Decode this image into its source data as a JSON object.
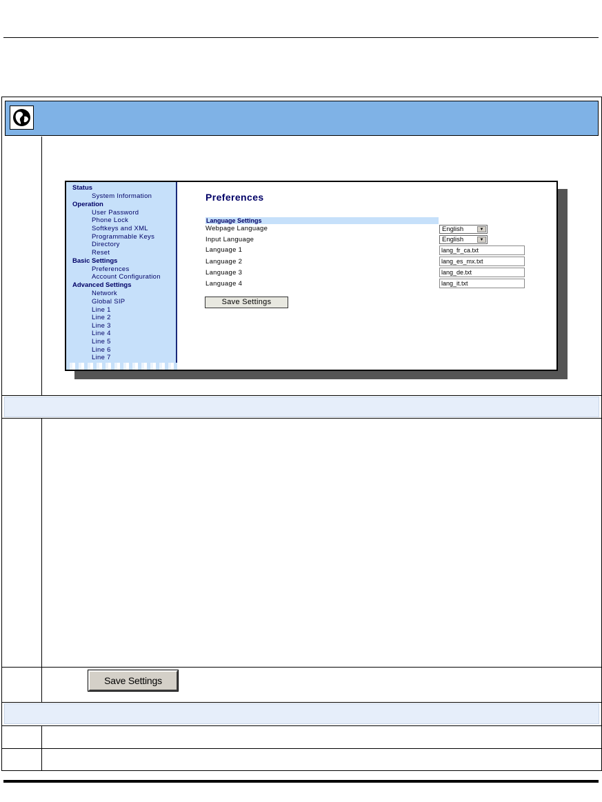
{
  "ui": {
    "sidebar": {
      "sections": [
        {
          "title": "Status",
          "items": [
            "System Information"
          ]
        },
        {
          "title": "Operation",
          "items": [
            "User Password",
            "Phone Lock",
            "Softkeys and XML",
            "Programmable Keys",
            "Directory",
            "Reset"
          ]
        },
        {
          "title": "Basic Settings",
          "items": [
            "Preferences",
            "Account Configuration"
          ]
        },
        {
          "title": "Advanced Settings",
          "items": [
            "Network",
            "Global SIP",
            "Line 1",
            "Line 2",
            "Line 3",
            "Line 4",
            "Line 5",
            "Line 6",
            "Line 7"
          ]
        }
      ]
    },
    "page_title": "Preferences",
    "language_settings_header": "Language Settings",
    "fields": [
      {
        "label": "Webpage Language",
        "type": "select",
        "value": "English"
      },
      {
        "label": "Input Language",
        "type": "select",
        "value": "English"
      },
      {
        "label": "Language 1",
        "type": "text",
        "value": "lang_fr_ca.txt"
      },
      {
        "label": "Language 2",
        "type": "text",
        "value": "lang_es_mx.txt"
      },
      {
        "label": "Language 3",
        "type": "text",
        "value": "lang_de.txt"
      },
      {
        "label": "Language 4",
        "type": "text",
        "value": "lang_it.txt"
      }
    ],
    "save_label": "Save Settings"
  },
  "doc": {
    "save_button_label": "Save Settings",
    "icon": "globe-icon"
  }
}
